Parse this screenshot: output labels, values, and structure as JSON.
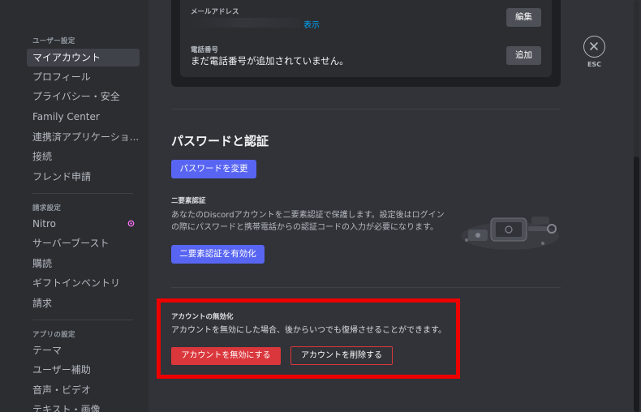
{
  "sidebar": {
    "user_settings_header": "ユーザー設定",
    "user_items": [
      "マイアカウント",
      "プロフィール",
      "プライバシー・安全",
      "Family Center",
      "連携済アプリケーショ...",
      "接続",
      "フレンド申請"
    ],
    "billing_header": "請求設定",
    "billing_items": [
      "Nitro",
      "サーバーブースト",
      "購読",
      "ギフトインベントリ",
      "請求"
    ],
    "app_header": "アプリの設定",
    "app_items": [
      "テーマ",
      "ユーザー補助",
      "音声・ビデオ",
      "テキスト・画像"
    ]
  },
  "account": {
    "email_label": "メールアドレス",
    "email_reveal": "表示",
    "email_edit": "編集",
    "phone_label": "電話番号",
    "phone_value": "まだ電話番号が追加されていません。",
    "phone_add": "追加"
  },
  "password_section": {
    "title": "パスワードと認証",
    "change_password": "パスワードを変更",
    "twofa_header": "二要素認証",
    "twofa_desc_1": "あなたのDiscordアカウントを二要素認証で保護します。設定後はログイン",
    "twofa_desc_2": "の際にパスワードと携帯電話からの認証コードの入力が必要になります。",
    "enable_2fa": "二要素認証を有効化"
  },
  "deactivate": {
    "header": "アカウントの無効化",
    "desc": "アカウントを無効にした場合、後からいつでも復帰させることができます。",
    "disable_button": "アカウントを無効にする",
    "delete_button": "アカウントを削除する"
  },
  "close": {
    "label": "ESC"
  },
  "colors": {
    "sidebar_bg": "#2b2d31",
    "content_bg": "#313338",
    "blurple": "#5865f2",
    "danger": "#da373c",
    "highlight": "#ed0000",
    "link": "#00a8fc"
  }
}
